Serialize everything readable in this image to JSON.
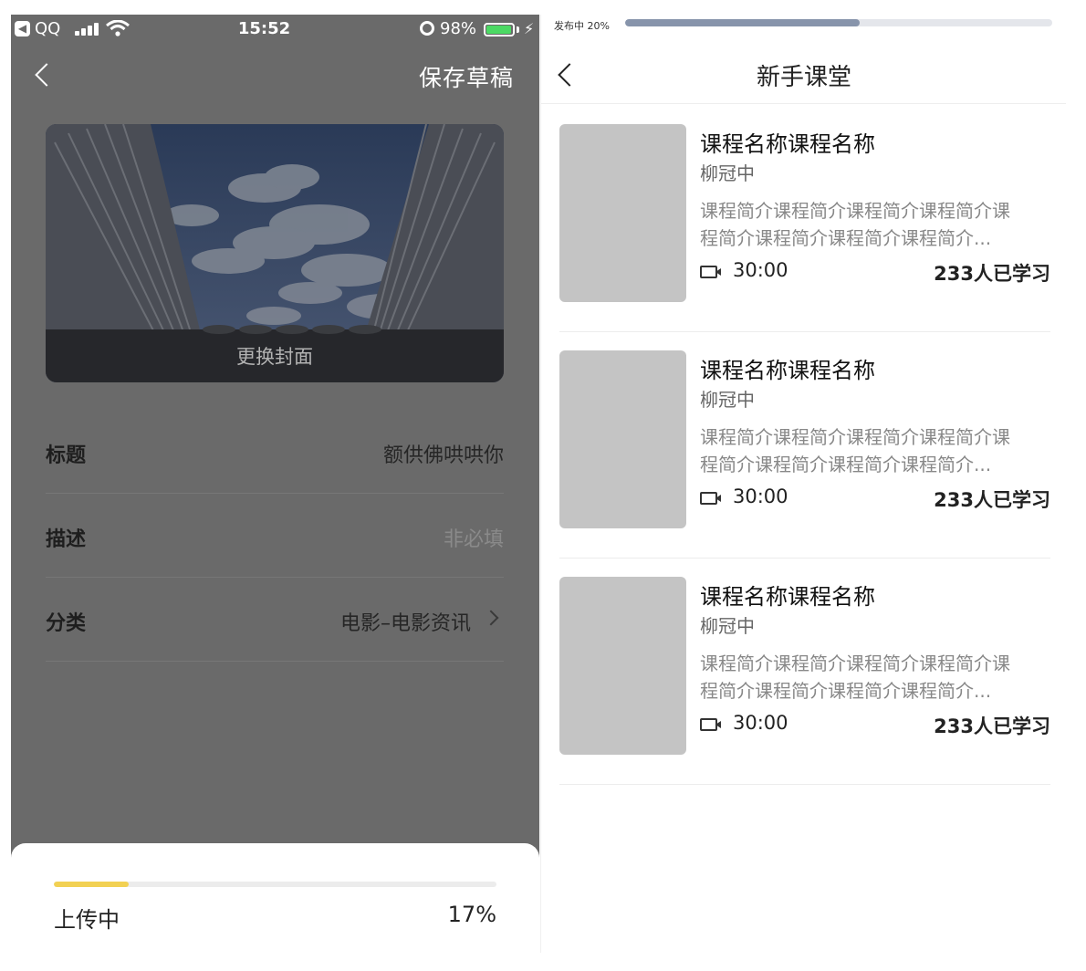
{
  "left_screen": {
    "status_bar": {
      "back_app": "QQ",
      "time": "15:52",
      "battery_percent": "98%",
      "battery_level": 0.98,
      "icons": [
        "back-to-app-icon",
        "signal-icon",
        "wifi-icon",
        "alarm-icon",
        "battery-icon",
        "charging-icon"
      ]
    },
    "nav": {
      "save_draft": "保存草稿"
    },
    "cover": {
      "change_label": "更换封面"
    },
    "form": {
      "title": {
        "label": "标题",
        "value": "额供佛哄哄你"
      },
      "description": {
        "label": "描述",
        "placeholder": "非必填"
      },
      "category": {
        "label": "分类",
        "value": "电影–电影资讯"
      }
    },
    "upload": {
      "label": "上传中",
      "percent_text": "17%",
      "progress": 0.17,
      "color": "#f2d153"
    }
  },
  "right_screen": {
    "publish": {
      "label": "发布中 20%",
      "progress": 0.55,
      "color": "#8794ab"
    },
    "nav": {
      "title": "新手课堂"
    },
    "courses": [
      {
        "title": "课程名称课程名称",
        "author": "柳冠中",
        "desc_line1": "课程简介课程简介课程简介课程简介课",
        "desc_line2": "程简介课程简介课程简介课程简介...",
        "duration": "30:00",
        "learners": "233人已学习"
      },
      {
        "title": "课程名称课程名称",
        "author": "柳冠中",
        "desc_line1": "课程简介课程简介课程简介课程简介课",
        "desc_line2": "程简介课程简介课程简介课程简介...",
        "duration": "30:00",
        "learners": "233人已学习"
      },
      {
        "title": "课程名称课程名称",
        "author": "柳冠中",
        "desc_line1": "课程简介课程简介课程简介课程简介课",
        "desc_line2": "程简介课程简介课程简介课程简介...",
        "duration": "30:00",
        "learners": "233人已学习"
      }
    ]
  }
}
